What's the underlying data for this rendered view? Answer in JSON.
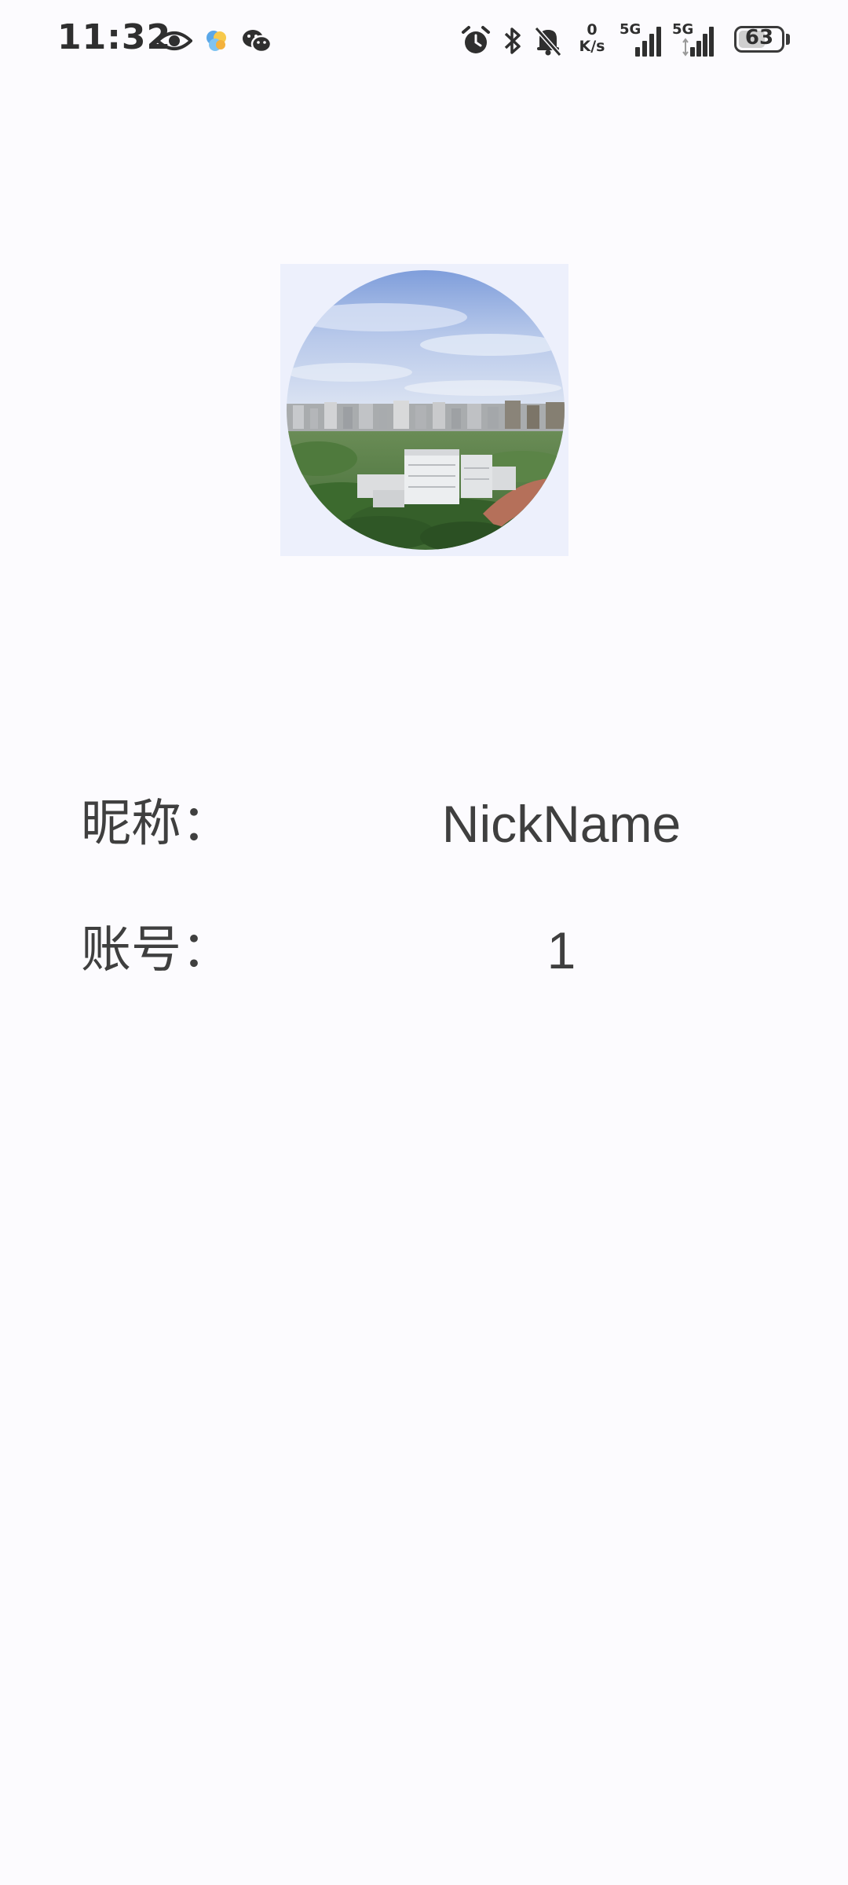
{
  "status_bar": {
    "time": "11:32",
    "net_speed_value": "0",
    "net_speed_unit": "K/s",
    "signal_1_label": "5G",
    "signal_2_label": "5G",
    "battery_level": "63",
    "icons": [
      "eye-icon",
      "app-notification-icon",
      "wechat-icon",
      "alarm-icon",
      "bluetooth-icon",
      "mute-bell-icon",
      "signal-icon",
      "battery-icon"
    ]
  },
  "profile": {
    "avatar_icon": "avatar-photo",
    "nickname_label": "昵称：",
    "nickname_value": "NickName",
    "account_label": "账号：",
    "account_value": "1"
  },
  "colors": {
    "background": "#fcfbfe",
    "text": "#3f3f3f"
  }
}
